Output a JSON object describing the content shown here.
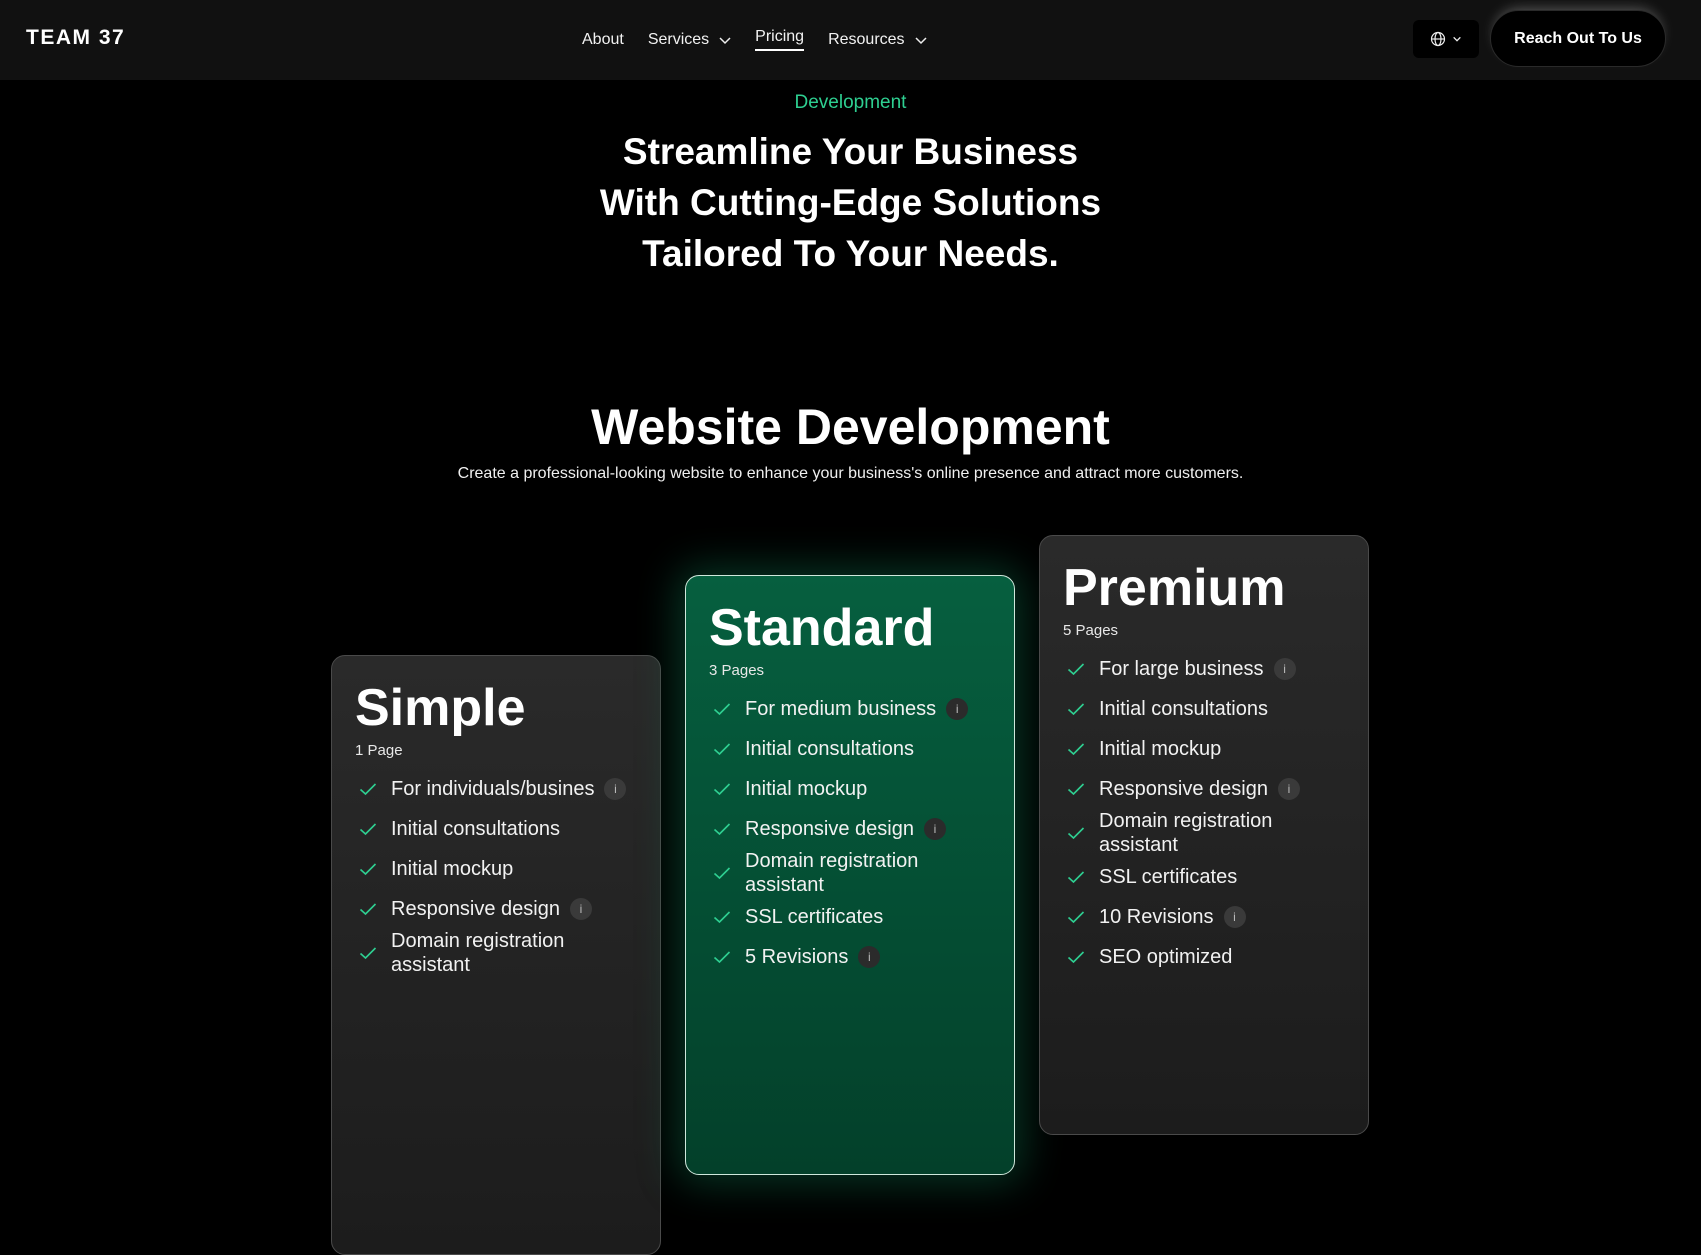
{
  "header": {
    "logo": "TEAM 37",
    "nav": [
      {
        "label": "About",
        "dropdown": false,
        "active": false
      },
      {
        "label": "Services",
        "dropdown": true,
        "active": false
      },
      {
        "label": "Pricing",
        "dropdown": false,
        "active": true
      },
      {
        "label": "Resources",
        "dropdown": true,
        "active": false
      }
    ],
    "language_icon": "globe-icon",
    "cta_label": "Reach Out To Us"
  },
  "hero": {
    "eyebrow": "Development",
    "title_lines": [
      "Streamline Your Business",
      "With Cutting-Edge Solutions",
      "Tailored To Your Needs."
    ]
  },
  "section": {
    "title": "Website Development",
    "subtitle": "Create a professional-looking website to enhance your business's online presence and attract more customers."
  },
  "colors": {
    "accent": "#2ecf91",
    "featured_card": "#065f3f",
    "card_dark": "#232323"
  },
  "plans": [
    {
      "name": "Simple",
      "pages": "1 Page",
      "features": [
        {
          "text": "For individuals/busines",
          "info": true
        },
        {
          "text": "Initial consultations",
          "info": false
        },
        {
          "text": "Initial mockup",
          "info": false
        },
        {
          "text": "Responsive design",
          "info": true
        },
        {
          "text": "Domain registration assistant",
          "info": false
        }
      ]
    },
    {
      "name": "Standard",
      "pages": "3 Pages",
      "features": [
        {
          "text": "For medium business",
          "info": true
        },
        {
          "text": "Initial consultations",
          "info": false
        },
        {
          "text": "Initial mockup",
          "info": false
        },
        {
          "text": "Responsive design",
          "info": true
        },
        {
          "text": "Domain registration assistant",
          "info": false
        },
        {
          "text": "SSL certificates",
          "info": false
        },
        {
          "text": "5 Revisions",
          "info": true
        }
      ]
    },
    {
      "name": "Premium",
      "pages": "5 Pages",
      "features": [
        {
          "text": "For large business",
          "info": true
        },
        {
          "text": "Initial consultations",
          "info": false
        },
        {
          "text": "Initial mockup",
          "info": false
        },
        {
          "text": "Responsive design",
          "info": true
        },
        {
          "text": "Domain registration assistant",
          "info": false
        },
        {
          "text": "SSL certificates",
          "info": false
        },
        {
          "text": "10 Revisions",
          "info": true
        },
        {
          "text": "SEO optimized",
          "info": false
        }
      ]
    }
  ]
}
